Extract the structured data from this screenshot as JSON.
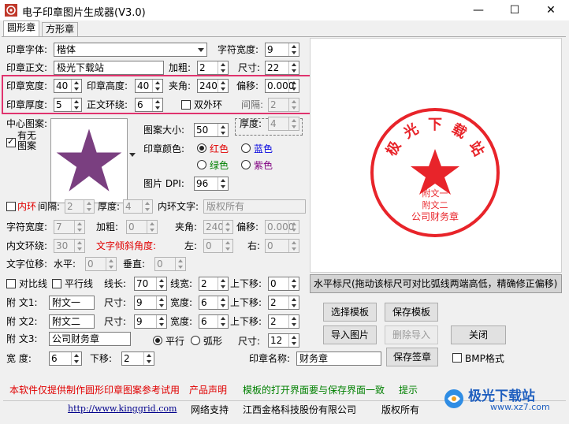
{
  "window": {
    "title": "电子印章图片生成器(V3.0)",
    "minimize": "—",
    "maximize": "☐",
    "close": "✕"
  },
  "tabs": [
    "圆形章",
    "方形章"
  ],
  "row1": {
    "font_label": "印章字体:",
    "font_value": "楷体",
    "char_width_label": "字符宽度:",
    "char_width_value": "9"
  },
  "row2": {
    "text_label": "印章正文:",
    "text_value": "极光下载站",
    "bold_label": "加粗:",
    "bold_value": "2",
    "size_label": "尺寸:",
    "size_value": "22"
  },
  "row3": {
    "width_label": "印章宽度:",
    "width_value": "40",
    "height_label": "印章高度:",
    "height_value": "40",
    "angle_label": "夹角:",
    "angle_value": "240",
    "offset_label": "偏移:",
    "offset_value": "0.000"
  },
  "row4": {
    "thick_label": "印章厚度:",
    "thick_value": "5",
    "ring_label": "正文环绕:",
    "ring_value": "6",
    "double_label": "双外环",
    "gap_label": "间隔:",
    "gap_value": "2"
  },
  "center": {
    "label": "中心图案:",
    "has_pattern_label": "有无图案",
    "pattern_size_label": "图案大小:",
    "pattern_size_value": "50",
    "thickness_label": "厚度:",
    "thickness_value": "4",
    "color_label": "印章颜色:",
    "colors": [
      {
        "label": "红色",
        "color": "#e00000"
      },
      {
        "label": "蓝色",
        "color": "#0000e0"
      },
      {
        "label": "绿色",
        "color": "#008000"
      },
      {
        "label": "紫色",
        "color": "#800080"
      }
    ],
    "dpi_label": "图片 DPI:",
    "dpi_value": "96",
    "star_color": "#7a3f80"
  },
  "inner": {
    "inner_ring_label": "内环",
    "gap_label": "间隔:",
    "gap_value": "2",
    "thick_label": "厚度:",
    "thick_value": "4",
    "text_label": "内环文字:",
    "text_value": "版权所有",
    "char_width_label": "字符宽度:",
    "char_width_value": "7",
    "bold_label": "加粗:",
    "bold_value": "0",
    "angle_label": "夹角:",
    "angle_value": "240",
    "offset_label": "偏移:",
    "offset_value": "0.000",
    "ring_label": "内文环绕:",
    "ring_value": "30",
    "tilt_label": "文字倾斜角度:",
    "left_label": "左:",
    "left_value": "0",
    "right_label": "右:",
    "right_value": "0",
    "shift_label": "文字位移:",
    "h_label": "水平:",
    "h_value": "0",
    "v_label": "垂直:",
    "v_value": "0"
  },
  "lines": {
    "contrast_label": "对比线",
    "parallel_label": "平行线",
    "length_label": "线长:",
    "length_value": "70",
    "width_label": "线宽:",
    "width_value": "2",
    "updown_label": "上下移:",
    "updown_value": "0"
  },
  "attach": [
    {
      "label": "附  文1:",
      "value": "附文一",
      "size": "9",
      "width": "6",
      "move": "2"
    },
    {
      "label": "附  文2:",
      "value": "附文二",
      "size": "9",
      "width": "6",
      "move": "2"
    }
  ],
  "attach3": {
    "label": "附  文3:",
    "value": "公司财务章",
    "flat_label": "平行",
    "arc_label": "弧形",
    "size_label": "尺寸:",
    "size_value": "12"
  },
  "attach_labels": {
    "size": "尺寸:",
    "width": "宽度:",
    "move": "上下移:"
  },
  "bottom_row": {
    "width_label": "宽   度:",
    "width_value": "6",
    "down_label": "下移:",
    "down_value": "2",
    "seal_name_label": "印章名称:",
    "seal_name_value": "财务章",
    "save_sign": "保存签章",
    "bmp_label": "BMP格式"
  },
  "buttons": {
    "select_template": "选择模板",
    "save_template": "保存模板",
    "import_image": "导入图片",
    "delete_import": "删除导入",
    "close": "关闭"
  },
  "ruler_text": "水平标尺(拖动该标尺可对比弧线两端高低，精确修正偏移)",
  "seal": {
    "top_chars": [
      "极",
      "光",
      "下",
      "载",
      "站"
    ],
    "sub1": "附文一",
    "sub2": "附文二",
    "company": "公司财务章",
    "color": "#e8242a"
  },
  "footer": {
    "notice": "本软件仅提供制作圆形印章图案参考试用",
    "declaration": "产品声明",
    "tip_text": "模板的打开界面要与保存界面一致",
    "tip": "提示",
    "url": "http://www.kinggrid.com",
    "support": "网络支持",
    "company": "江西金格科技股份有限公司",
    "rights": "版权所有"
  },
  "watermark": {
    "brand": "极光下载站",
    "url": "www.xz7.com"
  }
}
